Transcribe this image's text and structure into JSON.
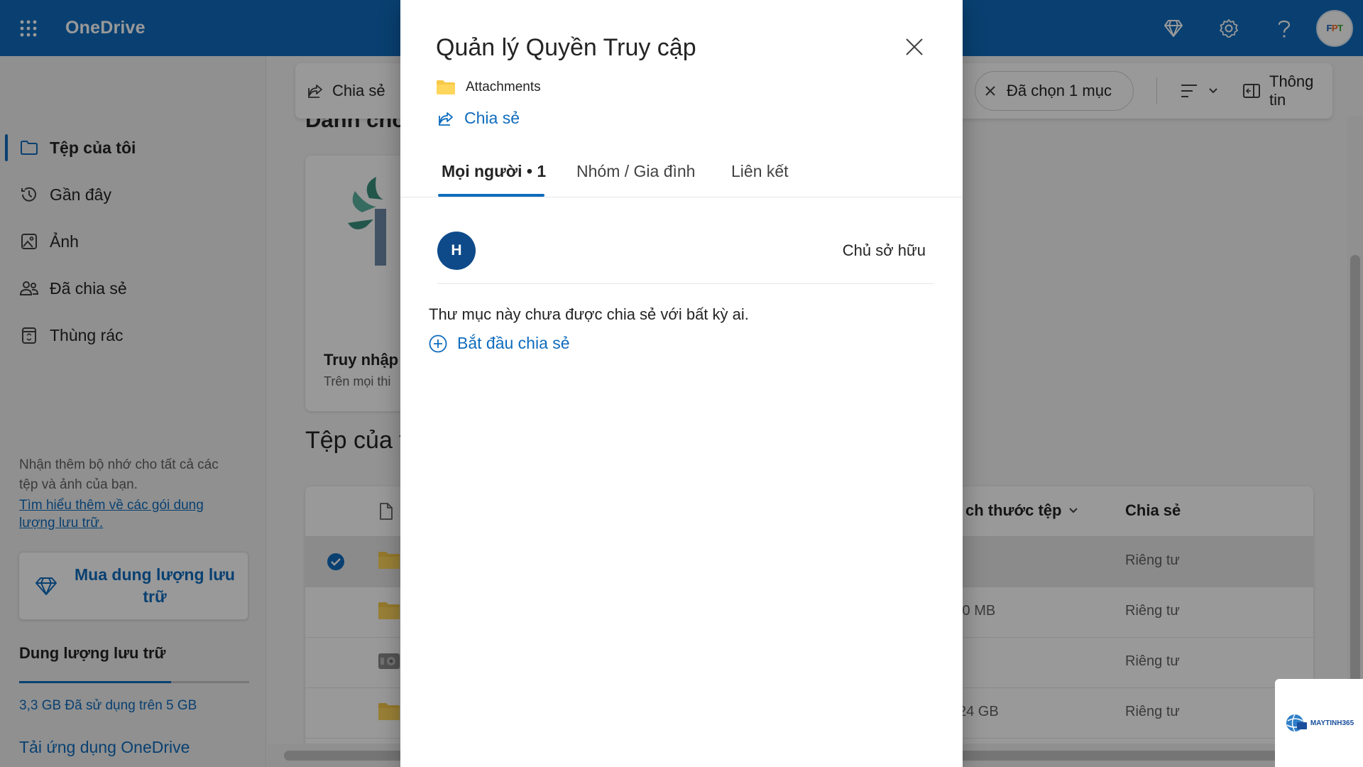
{
  "app": {
    "name": "OneDrive"
  },
  "topbar": {
    "icons": [
      "waffle-icon",
      "premium-diamond-icon",
      "settings-gear-icon",
      "help-question-icon"
    ],
    "avatar_text": "FPT"
  },
  "sidebar": {
    "items": [
      {
        "label": "Tệp của tôi",
        "icon": "folder-icon",
        "active": true
      },
      {
        "label": "Gần đây",
        "icon": "history-clock-icon",
        "active": false
      },
      {
        "label": "Ảnh",
        "icon": "photo-icon",
        "active": false
      },
      {
        "label": "Đã chia sẻ",
        "icon": "people-icon",
        "active": false
      },
      {
        "label": "Thùng rác",
        "icon": "recycle-bin-icon",
        "active": false
      }
    ],
    "promo_text": "Nhận thêm bộ nhớ cho tất cả các tệp và ảnh của bạn.",
    "promo_link": "Tìm hiểu thêm về các gói dung lượng lưu trữ.",
    "buy_button": "Mua dung lượng lưu trữ",
    "storage_title": "Dung lượng lưu trữ",
    "storage_used_fraction": 0.66,
    "storage_text": "3,3 GB Đã sử dụng trên 5 GB",
    "get_app": "Tải ứng dụng OneDrive"
  },
  "commandbar": {
    "share_label": "Chia sẻ",
    "selected_label": "Đã chọn 1 mục",
    "info_label": "Thông tin"
  },
  "main": {
    "section1_title": "Dành cho",
    "card_title": "Truy nhập",
    "card_subtitle": "Trên mọi thi",
    "section2_title": "Tệp của t",
    "columns": {
      "size": "ch thước tệp",
      "sharing": "Chia sẻ"
    },
    "rows": [
      {
        "size": "",
        "sharing": "Riêng tư",
        "selected": true,
        "icon": "folder"
      },
      {
        "size": ".0 MB",
        "sharing": "Riêng tư",
        "selected": false,
        "icon": "folder"
      },
      {
        "size": "",
        "sharing": "Riêng tư",
        "selected": false,
        "icon": "vault"
      },
      {
        "size": "24 GB",
        "sharing": "Riêng tư",
        "selected": false,
        "icon": "folder"
      }
    ]
  },
  "dialog": {
    "title": "Quản lý Quyền Truy cập",
    "folder_name": "Attachments",
    "share_link": "Chia sẻ",
    "tabs": [
      {
        "label": "Mọi người • 1",
        "active": true
      },
      {
        "label": "Nhóm / Gia đình",
        "active": false
      },
      {
        "label": "Liên kết",
        "active": false
      }
    ],
    "person": {
      "initial": "H",
      "role": "Chủ sở hữu"
    },
    "not_shared_text": "Thư mục này chưa được chia sẻ với bất kỳ ai.",
    "start_sharing": "Bắt đầu chia sẻ"
  },
  "watermark": {
    "text": "MAYTINH365"
  },
  "colors": {
    "brand_blue": "#0f6cbd",
    "avatar_blue": "#0e4a8a",
    "folder_yellow": "#f7c948"
  }
}
